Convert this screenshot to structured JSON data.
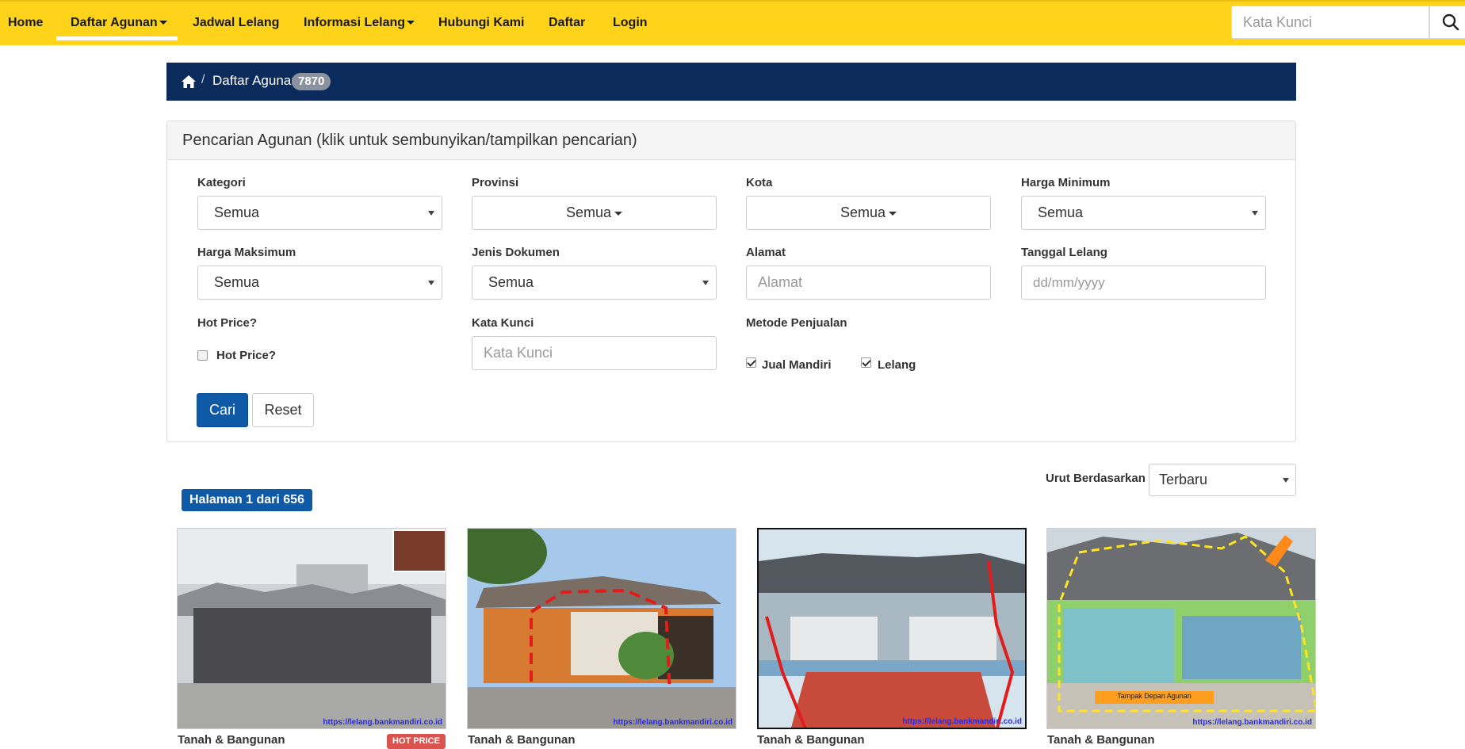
{
  "nav": {
    "items": [
      {
        "label": "Home"
      },
      {
        "label": "Daftar Agunan"
      },
      {
        "label": "Jadwal Lelang"
      },
      {
        "label": "Informasi Lelang"
      },
      {
        "label": "Hubungi Kami"
      },
      {
        "label": "Daftar"
      },
      {
        "label": "Login"
      }
    ],
    "search_placeholder": "Kata Kunci"
  },
  "breadcrumb": {
    "current": "Daftar Agunan",
    "count": "7870"
  },
  "search_panel": {
    "title": "Pencarian Agunan (klik untuk sembunyikan/tampilkan pencarian)",
    "kategori": {
      "label": "Kategori",
      "value": "Semua"
    },
    "provinsi": {
      "label": "Provinsi",
      "value": "Semua"
    },
    "kota": {
      "label": "Kota",
      "value": "Semua"
    },
    "harga_min": {
      "label": "Harga Minimum",
      "value": "Semua"
    },
    "harga_max": {
      "label": "Harga Maksimum",
      "value": "Semua"
    },
    "jenis_dokumen": {
      "label": "Jenis Dokumen",
      "value": "Semua"
    },
    "alamat": {
      "label": "Alamat",
      "placeholder": "Alamat"
    },
    "tanggal_lelang": {
      "label": "Tanggal Lelang",
      "placeholder": "dd/mm/yyyy"
    },
    "hot_price": {
      "label": "Hot Price?",
      "checkbox_label": "Hot Price?",
      "checked": false
    },
    "kata_kunci": {
      "label": "Kata Kunci",
      "placeholder": "Kata Kunci"
    },
    "metode": {
      "label": "Metode Penjualan",
      "options": [
        {
          "label": "Jual Mandiri",
          "checked": true
        },
        {
          "label": "Lelang",
          "checked": true
        }
      ]
    },
    "btn_cari": "Cari",
    "btn_reset": "Reset"
  },
  "sort": {
    "label": "Urut Berdasarkan",
    "value": "Terbaru"
  },
  "pagination": {
    "text": "Halaman 1 dari 656"
  },
  "listings": [
    {
      "type": "Tanah & Bangunan",
      "url": "https://lelang.bankmandiri.co.id",
      "hot_price": "HOT PRICE"
    },
    {
      "type": "Tanah & Bangunan",
      "url": "https://lelang.bankmandiri.co.id"
    },
    {
      "type": "Tanah & Bangunan",
      "url": "https://lelang.bankmandiri.co.id"
    },
    {
      "type": "Tanah & Bangunan",
      "url": "https://lelang.bankmandiri.co.id",
      "photo_label": "Tampak Depan Agunan"
    }
  ]
}
